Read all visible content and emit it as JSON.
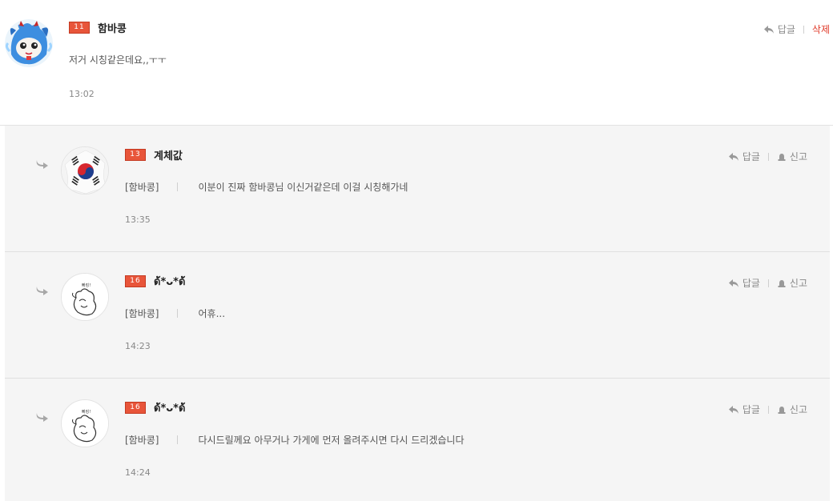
{
  "colors": {
    "level_badge": "#e8553a",
    "delete": "#e03a2a",
    "reply_bg": "#f5f5f5"
  },
  "main_comment": {
    "level": "11",
    "nickname": "함바콩",
    "text": "저거 시칭같은데요,,ㅜㅜ",
    "time": "13:02",
    "reply_label": "답글",
    "delete_label": "삭제",
    "avatar_icon": "blue-dragon-avatar"
  },
  "replies": [
    {
      "level": "13",
      "nickname": "계체값",
      "mention": "[함바콩]",
      "text": "이분이 진짜 함바콩님 이신거같은데 이걸 시칭해가네",
      "time": "13:35",
      "reply_label": "답글",
      "report_label": "신고",
      "avatar_icon": "korean-flag-avatar"
    },
    {
      "level": "16",
      "nickname": "ด้*ᴗ*ด้",
      "mention": "[함바콩]",
      "text": "어휴...",
      "time": "14:23",
      "reply_label": "답글",
      "report_label": "신고",
      "avatar_icon": "cartoon-character-avatar"
    },
    {
      "level": "16",
      "nickname": "ด้*ᴗ*ด้",
      "mention": "[함바콩]",
      "text": "다시드릴께요 아무거나 가게에 먼저 올려주시면 다시 드리겠습니다",
      "time": "14:24",
      "reply_label": "답글",
      "report_label": "신고",
      "avatar_icon": "cartoon-character-avatar"
    }
  ]
}
